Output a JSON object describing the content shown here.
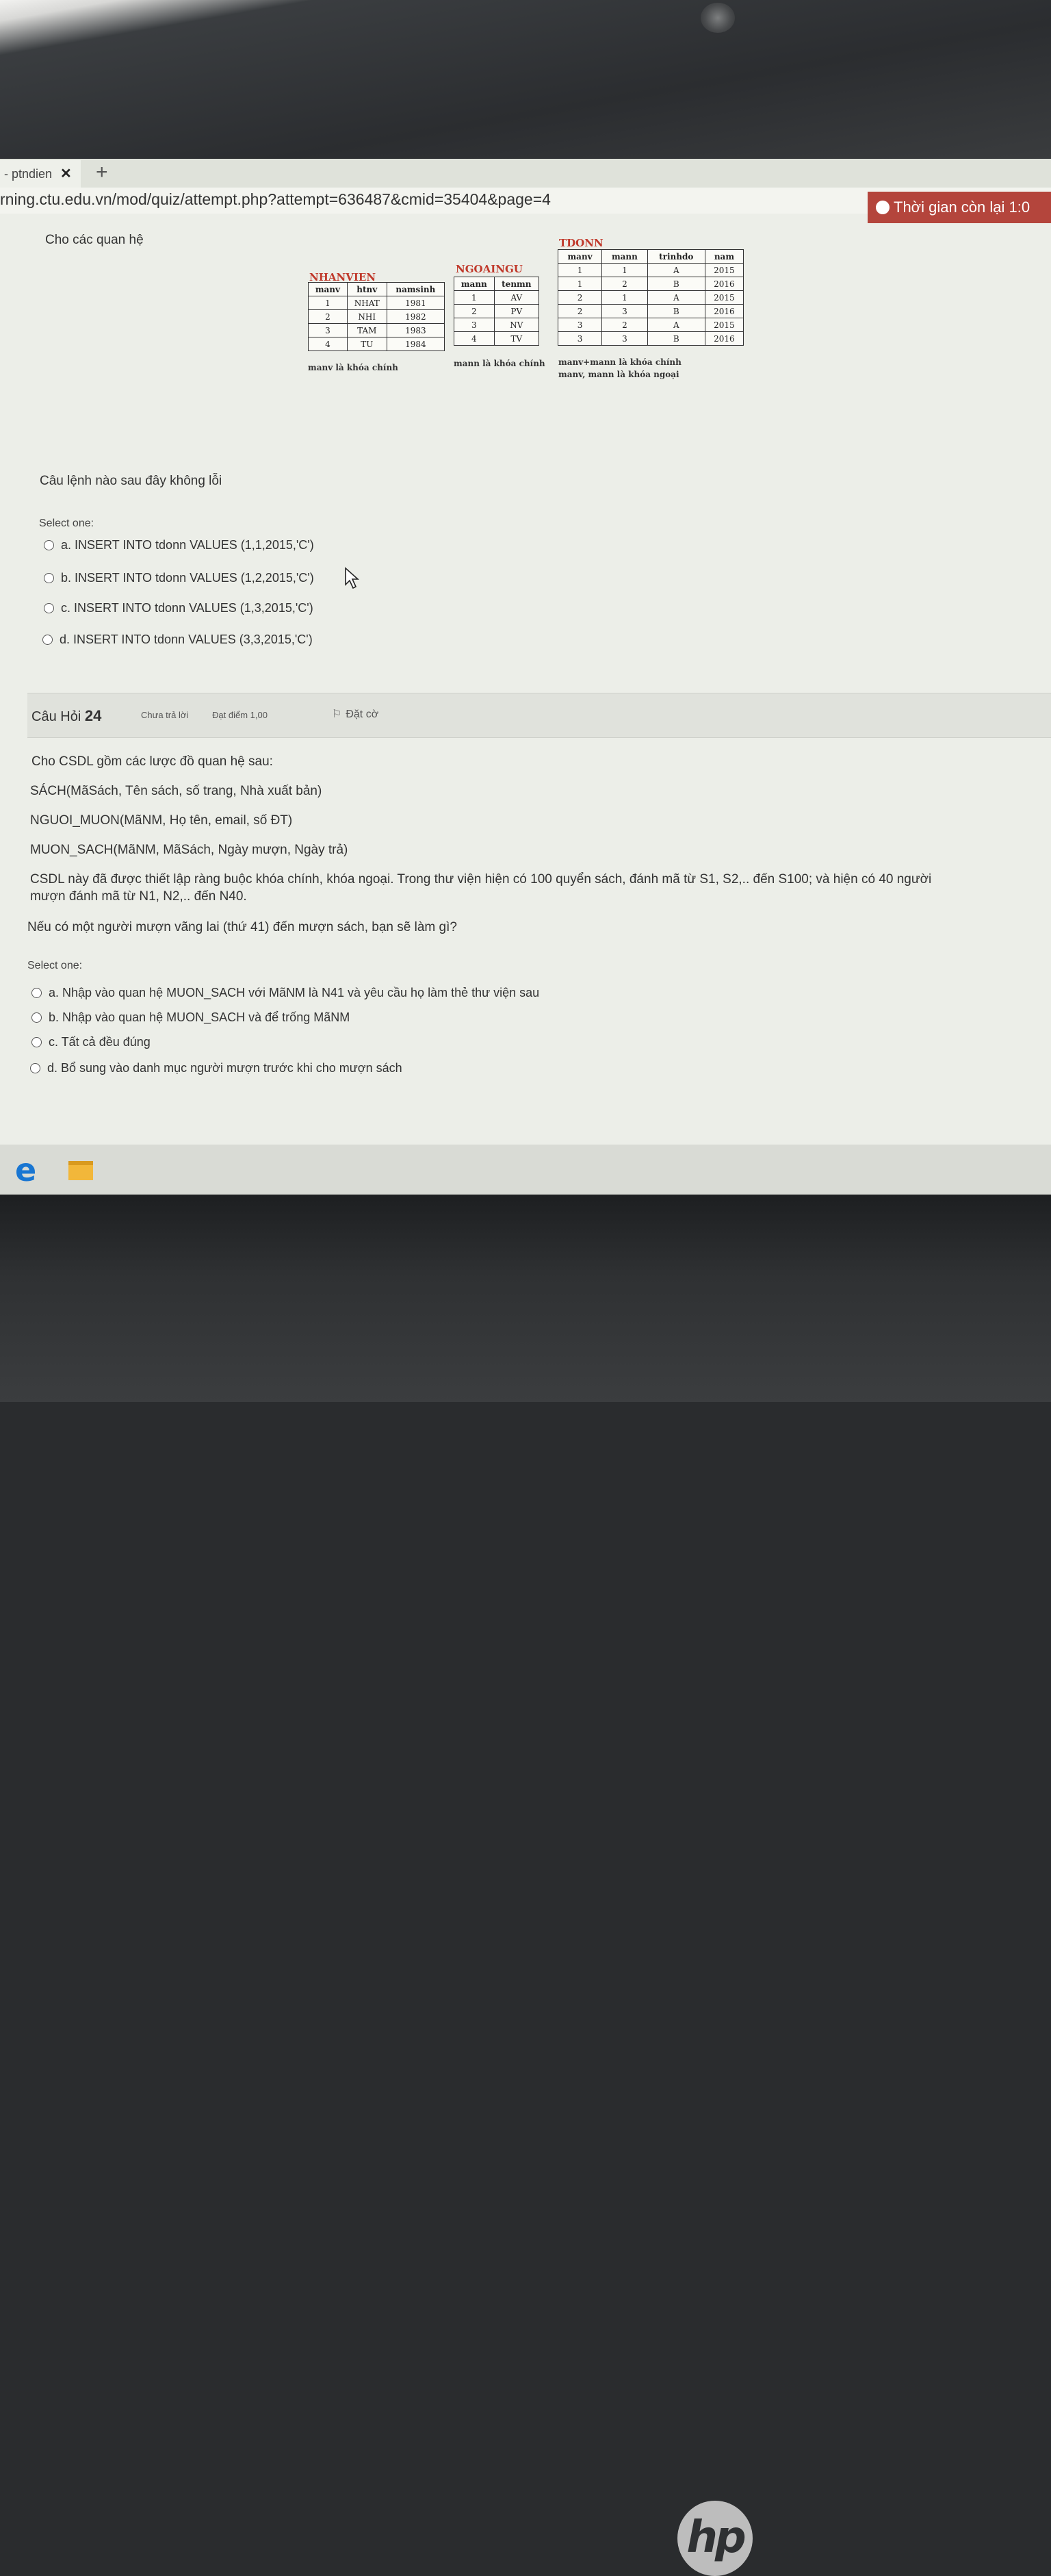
{
  "browser": {
    "tab_title": "- ptndien",
    "tab_close": "✕",
    "new_tab": "+",
    "url": "rning.ctu.edu.vn/mod/quiz/attempt.php?attempt=636487&cmid=35404&page=4"
  },
  "timer": {
    "label": "Thời gian còn lại 1:0"
  },
  "question23": {
    "intro": "Cho các quan hệ",
    "relations": {
      "nhanvien": {
        "title": "NHANVIEN",
        "headers": [
          "manv",
          "htnv",
          "namsinh"
        ],
        "rows": [
          [
            "1",
            "NHAT",
            "1981"
          ],
          [
            "2",
            "NHI",
            "1982"
          ],
          [
            "3",
            "TAM",
            "1983"
          ],
          [
            "4",
            "TU",
            "1984"
          ]
        ],
        "note": "manv là khóa chính"
      },
      "ngoaingu": {
        "title": "NGOAINGU",
        "headers": [
          "mann",
          "tenmn"
        ],
        "rows": [
          [
            "1",
            "AV"
          ],
          [
            "2",
            "PV"
          ],
          [
            "3",
            "NV"
          ],
          [
            "4",
            "TV"
          ]
        ],
        "note": "mann là khóa chính"
      },
      "tdonn": {
        "title": "TDONN",
        "headers": [
          "manv",
          "mann",
          "trinhdo",
          "nam"
        ],
        "rows": [
          [
            "1",
            "1",
            "A",
            "2015"
          ],
          [
            "1",
            "2",
            "B",
            "2016"
          ],
          [
            "2",
            "1",
            "A",
            "2015"
          ],
          [
            "2",
            "3",
            "B",
            "2016"
          ],
          [
            "3",
            "2",
            "A",
            "2015"
          ],
          [
            "3",
            "3",
            "B",
            "2016"
          ]
        ],
        "note1": "manv+mann là khóa chính",
        "note2": "manv, mann là khóa ngoại"
      }
    },
    "question": "Câu lệnh nào sau đây không lỗi",
    "select_one": "Select one:",
    "options": [
      "a.  INSERT INTO tdonn VALUES (1,1,2015,'C')",
      "b.  INSERT INTO tdonn VALUES (1,2,2015,'C')",
      "c.  INSERT INTO tdonn VALUES (1,3,2015,'C')",
      "d.  INSERT INTO tdonn VALUES (3,3,2015,'C')"
    ]
  },
  "question24": {
    "label": "Câu Hỏi",
    "number": "24",
    "status": "Chưa trả lời",
    "mark": "Đạt điểm 1,00",
    "flag": "Đặt cờ",
    "lines": [
      "Cho CSDL gồm các lược đồ quan hệ sau:",
      "SÁCH(MãSách, Tên sách, số trang, Nhà xuất bản)",
      "NGUOI_MUON(MãNM, Họ tên, email, số ĐT)",
      "MUON_SACH(MãNM, MãSách, Ngày mượn, Ngày trả)",
      "CSDL này đã được thiết lập ràng buộc khóa chính, khóa ngoại. Trong thư viện hiện có 100 quyển sách, đánh mã từ S1, S2,.. đến S100; và hiện có 40 người",
      "mượn đánh mã từ N1, N2,.. đến N40.",
      "Nếu có một người mượn vãng lai (thứ 41) đến mượn sách, bạn sẽ làm gì?"
    ],
    "select_one": "Select one:",
    "options": [
      "a.  Nhập vào quan hệ MUON_SACH với MãNM là N41 và yêu cầu họ làm thẻ thư viện sau",
      "b.  Nhập vào quan hệ MUON_SACH và để trống MãNM",
      "c.  Tất cả đều đúng",
      "d.  Bổ sung vào danh mục người mượn trước khi cho mượn sách"
    ]
  },
  "laptop": {
    "brand": "hp"
  },
  "colors": {
    "timer_bg": "#b4453c",
    "relation_title": "#c0392b"
  }
}
